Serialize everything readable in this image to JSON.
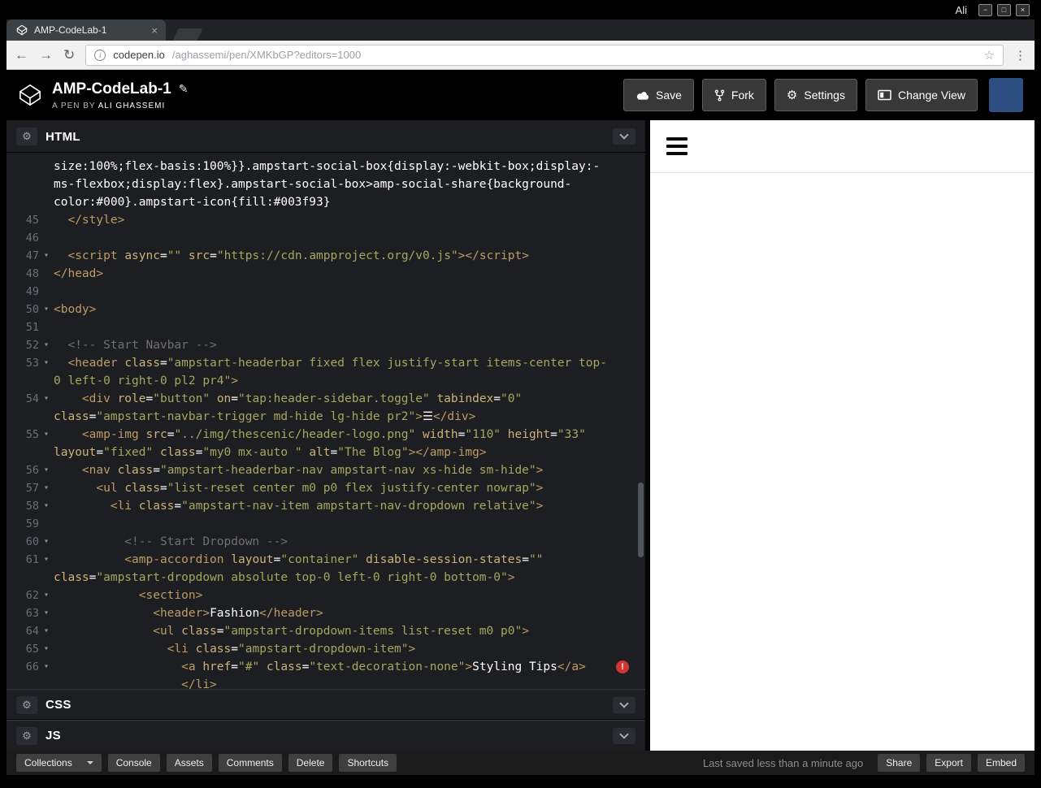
{
  "colors": {
    "editor_background": "#1d1e22",
    "syntax_tag": "#bf9b63",
    "syntax_attr": "#cdb378",
    "syntax_string": "#a5a75c",
    "syntax_comment": "#707070",
    "syntax_plain": "#ffffff",
    "error_red": "#d23434"
  },
  "icons": {
    "minimize": "−",
    "maximize": "□",
    "close": "×",
    "tab_close": "×",
    "back": "←",
    "forward": "→",
    "reload": "↻",
    "info": "i",
    "star": "☆",
    "dots": "⋮",
    "gear": "⚙",
    "pencil": "✎",
    "error": "!"
  },
  "browser": {
    "user_label": "Ali",
    "tab": {
      "title": "AMP-CodeLab-1"
    },
    "url": {
      "host": "codepen.io",
      "path": "/aghassemi/pen/XMKbGP?editors=1000"
    }
  },
  "pen_header": {
    "title": "AMP-CodeLab-1",
    "byline_prefix": "A PEN BY",
    "author": "Ali Ghassemi",
    "buttons": {
      "save": "Save",
      "fork": "Fork",
      "settings": "Settings",
      "change_view": "Change View"
    }
  },
  "editors": {
    "fold_icon": "▾",
    "html": {
      "label": "HTML"
    },
    "css": {
      "label": "CSS"
    },
    "js": {
      "label": "JS"
    },
    "rows": [
      {
        "n": "",
        "tk": [
          [
            "p",
            "size:100%;flex-basis:100%}}.ampstart-social-box{display:-webkit-box;display:-"
          ]
        ]
      },
      {
        "n": "",
        "tk": [
          [
            "p",
            "ms-flexbox;display:flex}.ampstart-social-box>amp-social-share{background-"
          ]
        ]
      },
      {
        "n": "",
        "tk": [
          [
            "p",
            "color:#000}.ampstart-icon{fill:#003f93}"
          ]
        ]
      },
      {
        "n": "45",
        "tk": [
          [
            "t",
            "  </style>"
          ]
        ]
      },
      {
        "n": "46",
        "tk": []
      },
      {
        "n": "47",
        "f": true,
        "tk": [
          [
            "t",
            "  <script "
          ],
          [
            "a",
            "async"
          ],
          [
            "p",
            "="
          ],
          [
            "s",
            "\"\""
          ],
          [
            "p",
            " "
          ],
          [
            "a",
            "src"
          ],
          [
            "p",
            "="
          ],
          [
            "s",
            "\"https://cdn.ampproject.org/v0.js\""
          ],
          [
            "t",
            "></script>"
          ]
        ]
      },
      {
        "n": "48",
        "tk": [
          [
            "t",
            "</head>"
          ]
        ]
      },
      {
        "n": "49",
        "tk": []
      },
      {
        "n": "50",
        "f": true,
        "tk": [
          [
            "t",
            "<body>"
          ]
        ]
      },
      {
        "n": "51",
        "tk": []
      },
      {
        "n": "52",
        "f": true,
        "tk": [
          [
            "c",
            "  <!-- Start Navbar -->"
          ]
        ]
      },
      {
        "n": "53",
        "f": true,
        "tk": [
          [
            "t",
            "  <header "
          ],
          [
            "a",
            "class"
          ],
          [
            "p",
            "="
          ],
          [
            "s",
            "\"ampstart-headerbar fixed flex justify-start items-center top-"
          ]
        ]
      },
      {
        "n": "",
        "tk": [
          [
            "s",
            "0 left-0 right-0 pl2 pr4\""
          ],
          [
            "t",
            ">"
          ]
        ]
      },
      {
        "n": "54",
        "f": true,
        "tk": [
          [
            "t",
            "    <div "
          ],
          [
            "a",
            "role"
          ],
          [
            "p",
            "="
          ],
          [
            "s",
            "\"button\""
          ],
          [
            "p",
            " "
          ],
          [
            "a",
            "on"
          ],
          [
            "p",
            "="
          ],
          [
            "s",
            "\"tap:header-sidebar.toggle\""
          ],
          [
            "p",
            " "
          ],
          [
            "a",
            "tabindex"
          ],
          [
            "p",
            "="
          ],
          [
            "s",
            "\"0\""
          ]
        ]
      },
      {
        "n": "",
        "tk": [
          [
            "a",
            "class"
          ],
          [
            "p",
            "="
          ],
          [
            "s",
            "\"ampstart-navbar-trigger md-hide lg-hide pr2\""
          ],
          [
            "t",
            ">"
          ],
          [
            "p",
            "☰"
          ],
          [
            "t",
            "</div>"
          ]
        ]
      },
      {
        "n": "55",
        "f": true,
        "tk": [
          [
            "t",
            "    <amp-img "
          ],
          [
            "a",
            "src"
          ],
          [
            "p",
            "="
          ],
          [
            "s",
            "\"../img/thescenic/header-logo.png\""
          ],
          [
            "p",
            " "
          ],
          [
            "a",
            "width"
          ],
          [
            "p",
            "="
          ],
          [
            "s",
            "\"110\""
          ],
          [
            "p",
            " "
          ],
          [
            "a",
            "height"
          ],
          [
            "p",
            "="
          ],
          [
            "s",
            "\"33\""
          ]
        ]
      },
      {
        "n": "",
        "tk": [
          [
            "a",
            "layout"
          ],
          [
            "p",
            "="
          ],
          [
            "s",
            "\"fixed\""
          ],
          [
            "p",
            " "
          ],
          [
            "a",
            "class"
          ],
          [
            "p",
            "="
          ],
          [
            "s",
            "\"my0 mx-auto \""
          ],
          [
            "p",
            " "
          ],
          [
            "a",
            "alt"
          ],
          [
            "p",
            "="
          ],
          [
            "s",
            "\"The Blog\""
          ],
          [
            "t",
            "></amp-img>"
          ]
        ]
      },
      {
        "n": "56",
        "f": true,
        "tk": [
          [
            "t",
            "    <nav "
          ],
          [
            "a",
            "class"
          ],
          [
            "p",
            "="
          ],
          [
            "s",
            "\"ampstart-headerbar-nav ampstart-nav xs-hide sm-hide\""
          ],
          [
            "t",
            ">"
          ]
        ]
      },
      {
        "n": "57",
        "f": true,
        "tk": [
          [
            "t",
            "      <ul "
          ],
          [
            "a",
            "class"
          ],
          [
            "p",
            "="
          ],
          [
            "s",
            "\"list-reset center m0 p0 flex justify-center nowrap\""
          ],
          [
            "t",
            ">"
          ]
        ]
      },
      {
        "n": "58",
        "f": true,
        "tk": [
          [
            "t",
            "        <li "
          ],
          [
            "a",
            "class"
          ],
          [
            "p",
            "="
          ],
          [
            "s",
            "\"ampstart-nav-item ampstart-nav-dropdown relative\""
          ],
          [
            "t",
            ">"
          ]
        ]
      },
      {
        "n": "59",
        "tk": []
      },
      {
        "n": "60",
        "f": true,
        "tk": [
          [
            "c",
            "          <!-- Start Dropdown -->"
          ]
        ]
      },
      {
        "n": "61",
        "f": true,
        "tk": [
          [
            "t",
            "          <amp-accordion "
          ],
          [
            "a",
            "layout"
          ],
          [
            "p",
            "="
          ],
          [
            "s",
            "\"container\""
          ],
          [
            "p",
            " "
          ],
          [
            "a",
            "disable-session-states"
          ],
          [
            "p",
            "="
          ],
          [
            "s",
            "\"\""
          ]
        ]
      },
      {
        "n": "",
        "tk": [
          [
            "a",
            "class"
          ],
          [
            "p",
            "="
          ],
          [
            "s",
            "\"ampstart-dropdown absolute top-0 left-0 right-0 bottom-0\""
          ],
          [
            "t",
            ">"
          ]
        ]
      },
      {
        "n": "62",
        "f": true,
        "tk": [
          [
            "t",
            "            <section>"
          ]
        ]
      },
      {
        "n": "63",
        "f": true,
        "tk": [
          [
            "t",
            "              <header>"
          ],
          [
            "p",
            "Fashion"
          ],
          [
            "t",
            "</header>"
          ]
        ]
      },
      {
        "n": "64",
        "f": true,
        "tk": [
          [
            "t",
            "              <ul "
          ],
          [
            "a",
            "class"
          ],
          [
            "p",
            "="
          ],
          [
            "s",
            "\"ampstart-dropdown-items list-reset m0 p0\""
          ],
          [
            "t",
            ">"
          ]
        ]
      },
      {
        "n": "65",
        "f": true,
        "tk": [
          [
            "t",
            "                <li "
          ],
          [
            "a",
            "class"
          ],
          [
            "p",
            "="
          ],
          [
            "s",
            "\"ampstart-dropdown-item\""
          ],
          [
            "t",
            ">"
          ]
        ]
      },
      {
        "n": "66",
        "f": true,
        "err": true,
        "tk": [
          [
            "t",
            "                  <a "
          ],
          [
            "a",
            "href"
          ],
          [
            "p",
            "="
          ],
          [
            "s",
            "\"#\""
          ],
          [
            "p",
            " "
          ],
          [
            "a",
            "class"
          ],
          [
            "p",
            "="
          ],
          [
            "s",
            "\"text-decoration-none\""
          ],
          [
            "t",
            ">"
          ],
          [
            "p",
            "Styling Tips"
          ],
          [
            "t",
            "</a>"
          ]
        ]
      },
      {
        "n": "",
        "tk": [
          [
            "t",
            "                  </li>"
          ]
        ]
      }
    ]
  },
  "footer": {
    "collections": "Collections",
    "buttons": [
      "Console",
      "Assets",
      "Comments",
      "Delete",
      "Shortcuts"
    ],
    "status": "Last saved less than a minute ago",
    "actions": [
      "Share",
      "Export",
      "Embed"
    ]
  }
}
